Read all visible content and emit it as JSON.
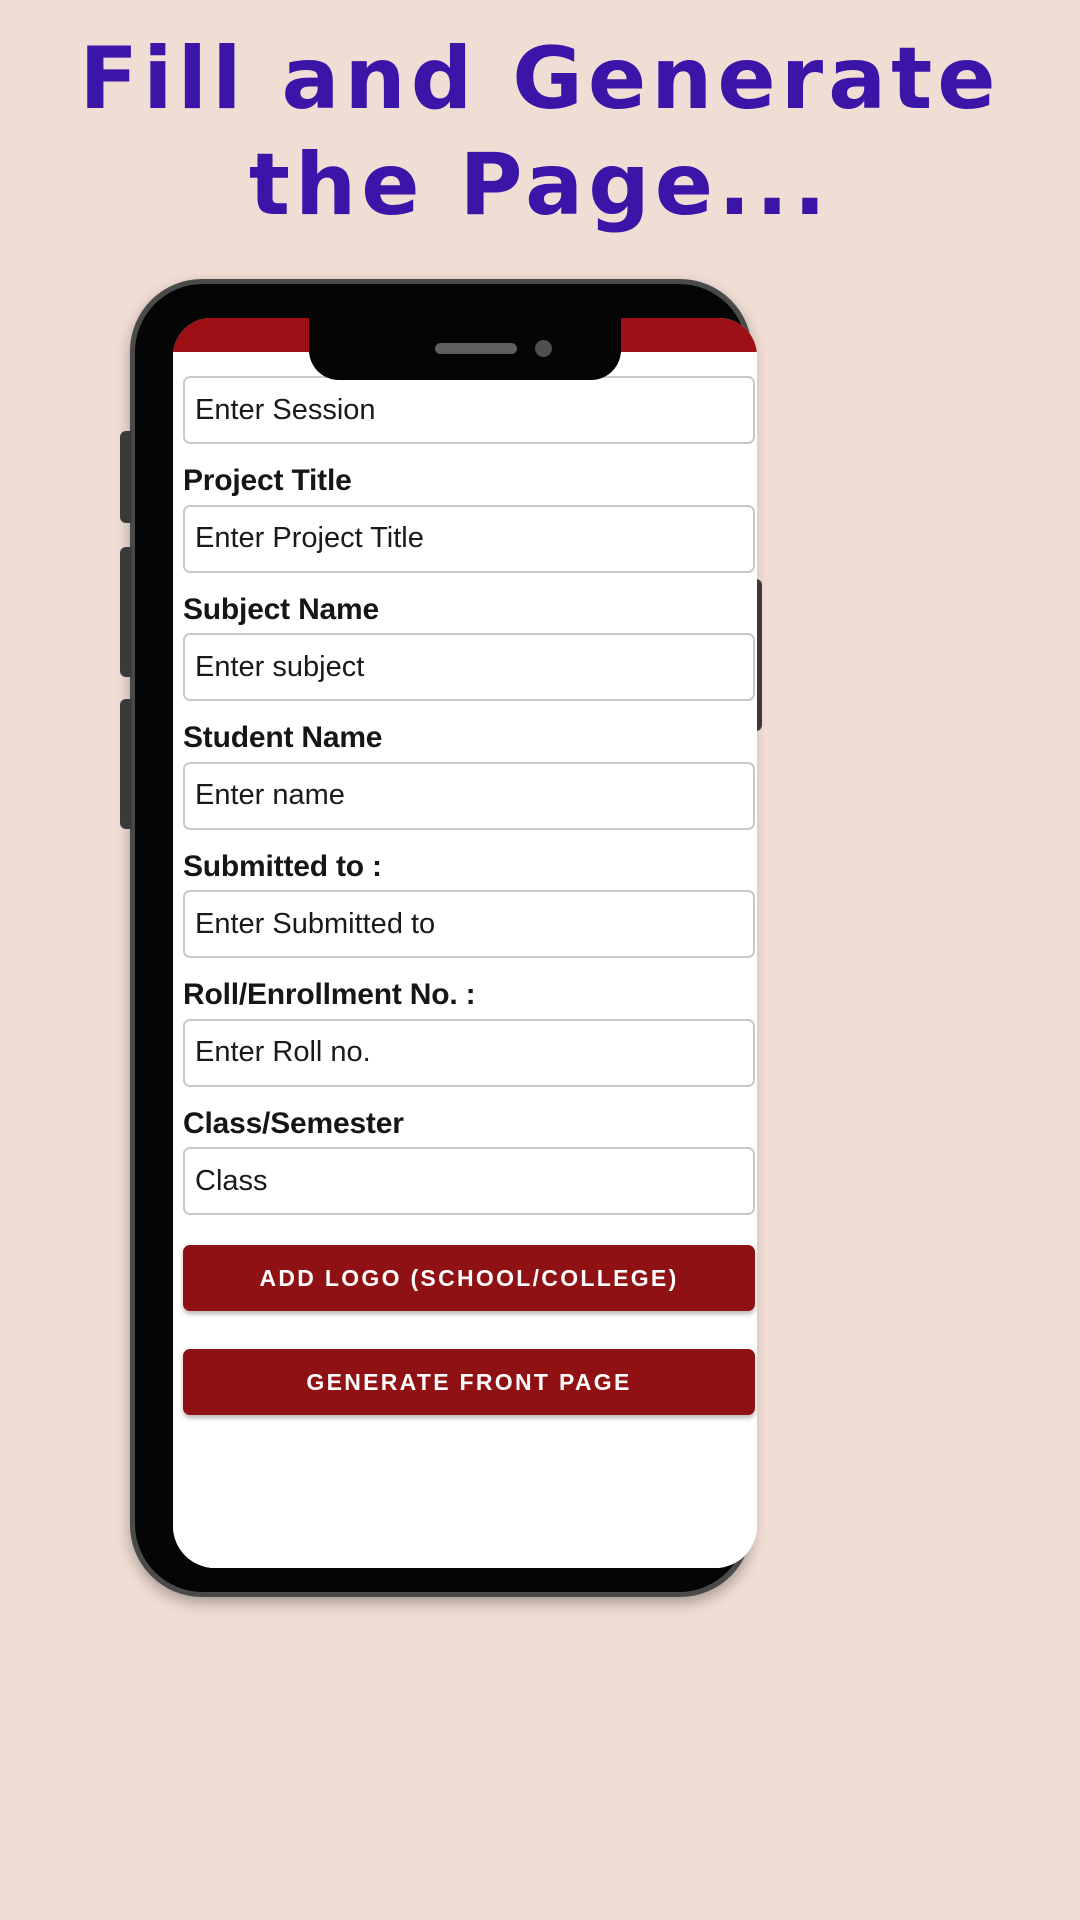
{
  "page": {
    "background_color": "#f0ddd3",
    "headline_color": "#3b14a8",
    "accent_color": "#8f1113"
  },
  "headline": {
    "line1": "Fill and Generate",
    "line2": "the Page..."
  },
  "phone": {
    "status_bar_color": "#9d1015",
    "notch": {
      "speaker_label": "speaker-grille",
      "camera_label": "front-camera"
    },
    "buttons": {
      "left_mute": "mute-switch",
      "left_volume_up": "volume-up-button",
      "left_volume_down": "volume-down-button",
      "right_power": "power-button"
    }
  },
  "form": {
    "fields": [
      {
        "label": "",
        "placeholder": "Enter Session",
        "name": "session"
      },
      {
        "label": "Project Title",
        "placeholder": "Enter Project Title",
        "name": "project-title"
      },
      {
        "label": "Subject Name",
        "placeholder": "Enter subject",
        "name": "subject-name"
      },
      {
        "label": "Student Name",
        "placeholder": "Enter name",
        "name": "student-name"
      },
      {
        "label": "Submitted to :",
        "placeholder": "Enter Submitted to",
        "name": "submitted-to"
      },
      {
        "label": "Roll/Enrollment No. :",
        "placeholder": "Enter Roll no.",
        "name": "roll-no"
      },
      {
        "label": "Class/Semester",
        "placeholder": "Class",
        "name": "class-semester"
      }
    ],
    "buttons": [
      {
        "label": "ADD LOGO (SCHOOL/COLLEGE)",
        "name": "add-logo"
      },
      {
        "label": "GENERATE FRONT PAGE",
        "name": "generate-front-page"
      }
    ]
  }
}
